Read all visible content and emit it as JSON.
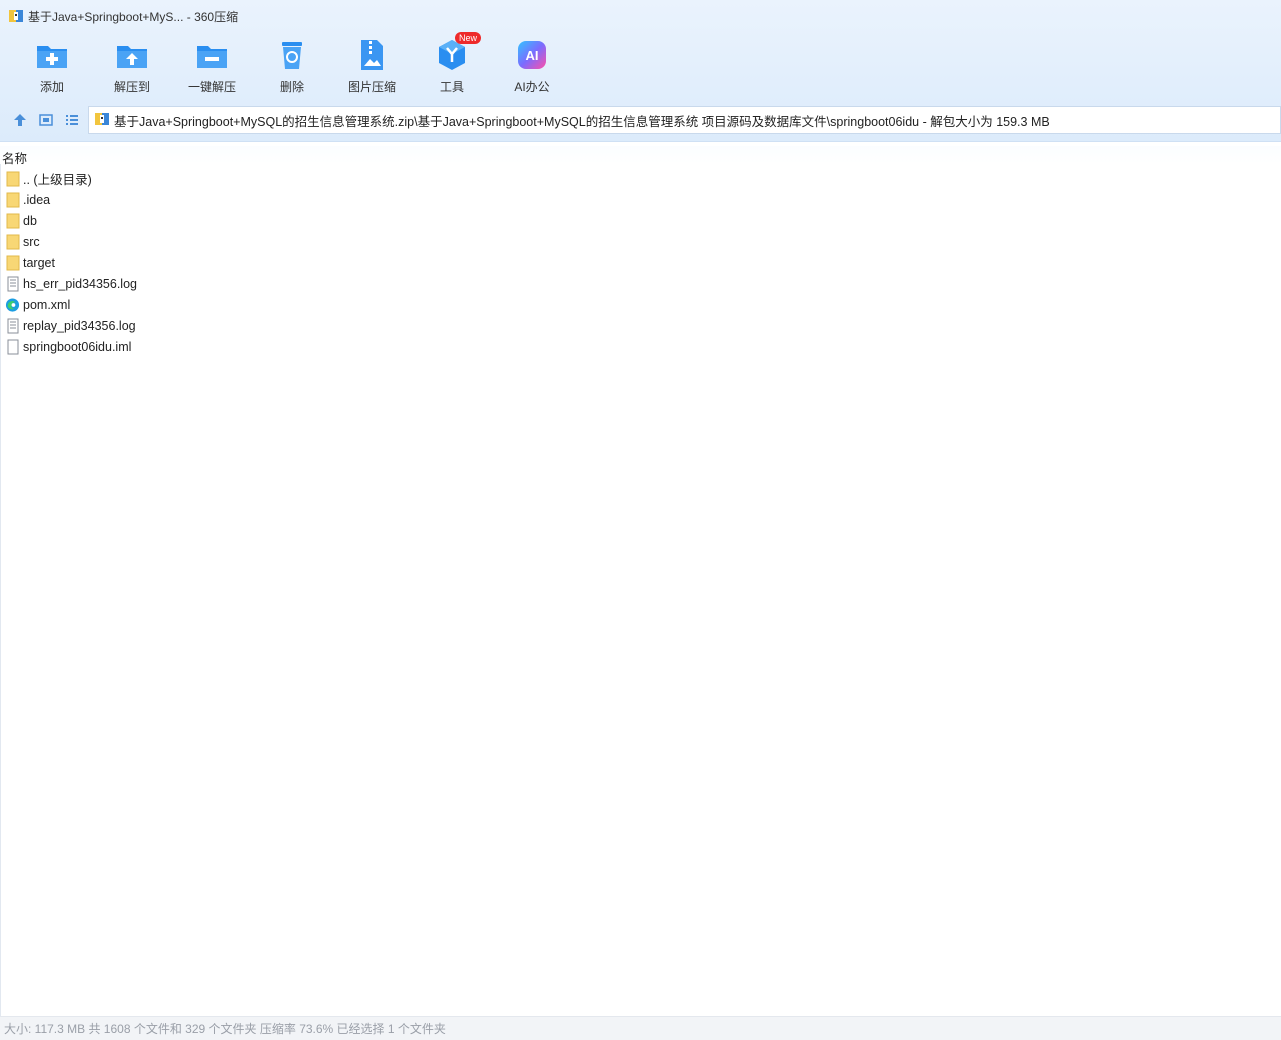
{
  "window": {
    "title": "基于Java+Springboot+MyS... - 360压缩"
  },
  "toolbar": {
    "items": [
      {
        "label": "添加",
        "icon": "add-folder-icon"
      },
      {
        "label": "解压到",
        "icon": "extract-to-icon"
      },
      {
        "label": "一键解压",
        "icon": "one-click-extract-icon"
      },
      {
        "label": "删除",
        "icon": "delete-bin-icon"
      },
      {
        "label": "图片压缩",
        "icon": "image-compress-icon"
      },
      {
        "label": "工具",
        "icon": "tools-icon",
        "badge": "New"
      },
      {
        "label": "AI办公",
        "icon": "ai-office-icon",
        "glyph": "AI"
      }
    ]
  },
  "address": {
    "path": "基于Java+Springboot+MySQL的招生信息管理系统.zip\\基于Java+Springboot+MySQL的招生信息管理系统 项目源码及数据库文件\\springboot06idu - 解包大小为 159.3 MB"
  },
  "list": {
    "column_name": "名称",
    "files": [
      {
        "name": ".. (上级目录)",
        "icon": "folder-icon"
      },
      {
        "name": ".idea",
        "icon": "folder-icon"
      },
      {
        "name": "db",
        "icon": "folder-icon"
      },
      {
        "name": "src",
        "icon": "folder-icon"
      },
      {
        "name": "target",
        "icon": "folder-icon"
      },
      {
        "name": "hs_err_pid34356.log",
        "icon": "text-file-icon"
      },
      {
        "name": "pom.xml",
        "icon": "edge-browser-icon"
      },
      {
        "name": "replay_pid34356.log",
        "icon": "text-file-icon"
      },
      {
        "name": "springboot06idu.iml",
        "icon": "blank-file-icon"
      }
    ]
  },
  "status": {
    "text": "大小: 117.3 MB 共 1608 个文件和 329 个文件夹 压缩率 73.6% 已经选择 1 个文件夹"
  },
  "colors": {
    "accent": "#2a8ef0",
    "folder": "#f8d775",
    "badge": "#ee2a2a"
  }
}
